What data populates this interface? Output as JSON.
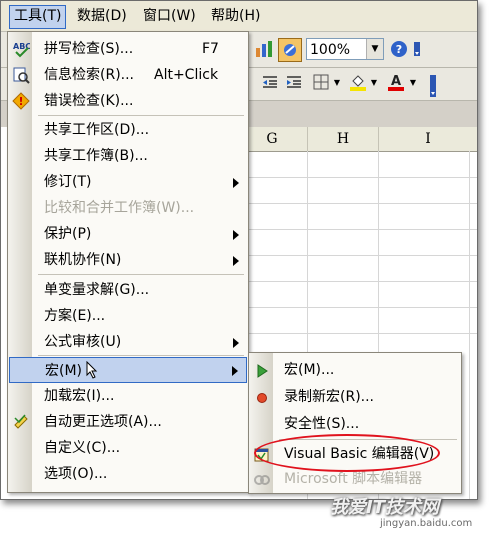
{
  "menubar": {
    "items": [
      {
        "label": "工具(T)",
        "active": true
      },
      {
        "label": "数据(D)"
      },
      {
        "label": "窗口(W)"
      },
      {
        "label": "帮助(H)"
      }
    ]
  },
  "toolbar": {
    "zoom": "100%"
  },
  "sheet": {
    "columns": [
      "G",
      "H",
      "I"
    ]
  },
  "tools_menu": {
    "items": [
      {
        "label": "拼写检查(S)...",
        "shortcut": "F7",
        "icon": "spellcheck-icon"
      },
      {
        "label": "信息检索(R)...",
        "shortcut": "Alt+Click",
        "icon": "research-icon"
      },
      {
        "label": "错误检查(K)...",
        "icon": "error-check-icon"
      },
      {
        "label": "共享工作区(D)..."
      },
      {
        "label": "共享工作簿(B)..."
      },
      {
        "label": "修订(T)",
        "submenu": true
      },
      {
        "label": "比较和合并工作簿(W)...",
        "disabled": true
      },
      {
        "label": "保护(P)",
        "submenu": true
      },
      {
        "label": "联机协作(N)",
        "submenu": true
      },
      {
        "label": "单变量求解(G)..."
      },
      {
        "label": "方案(E)..."
      },
      {
        "label": "公式审核(U)",
        "submenu": true
      },
      {
        "label": "宏(M)",
        "submenu": true,
        "highlighted": true
      },
      {
        "label": "加载宏(I)..."
      },
      {
        "label": "自动更正选项(A)...",
        "icon": "autocorrect-icon"
      },
      {
        "label": "自定义(C)..."
      },
      {
        "label": "选项(O)..."
      }
    ]
  },
  "macro_submenu": {
    "items": [
      {
        "label": "宏(M)...",
        "icon": "play-icon"
      },
      {
        "label": "录制新宏(R)...",
        "icon": "record-icon"
      },
      {
        "label": "安全性(S)..."
      },
      {
        "label": "Visual Basic 编辑器(V)",
        "icon": "vb-editor-icon",
        "circled": true
      },
      {
        "label": "Microsoft 脚本编辑器",
        "disabled": true,
        "icon": "script-editor-icon"
      }
    ]
  },
  "watermark": {
    "text": "我爱IT技术网",
    "sub": "jingyan.baidu.com"
  },
  "colors": {
    "highlight": "#c1d2ee",
    "highlight_border": "#316ac5",
    "oval": "#e0121d"
  }
}
